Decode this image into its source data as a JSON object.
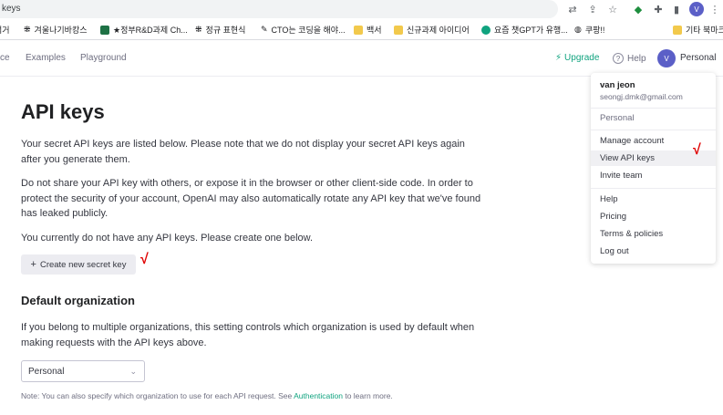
{
  "browser": {
    "address_text": "keys",
    "profile_initial": "V",
    "bookmarks": [
      {
        "label": "검거",
        "icon": "doc-icon",
        "color": "#5f6368"
      },
      {
        "label": "겨울나기바캉스",
        "icon": "t-icon",
        "color": "#333333"
      },
      {
        "label": "★정부R&D과제 Ch...",
        "icon": "excel-icon",
        "color": "#1e7145"
      },
      {
        "label": "정규 표현식",
        "icon": "t-icon",
        "color": "#333333"
      },
      {
        "label": "CTO는 코딩을 해야...",
        "icon": "pen-icon",
        "color": "#333333"
      },
      {
        "label": "백서",
        "icon": "folder-icon",
        "color": "#f2c94c"
      },
      {
        "label": "신규과제 아이디어",
        "icon": "folder-icon",
        "color": "#f2c94c"
      },
      {
        "label": "요즘 챗GPT가 유행...",
        "icon": "gpt-icon",
        "color": "#10a37f"
      },
      {
        "label": "쿠팡!!",
        "icon": "globe-icon",
        "color": "#333333"
      },
      {
        "label": "기타 북마크",
        "icon": "folder-icon",
        "color": "#f2c94c"
      }
    ]
  },
  "nav": {
    "partial_link": "ce",
    "examples": "Examples",
    "playground": "Playground",
    "upgrade": "Upgrade",
    "help": "Help",
    "avatar_initial": "V",
    "account": "Personal"
  },
  "main": {
    "title": "API keys",
    "para1": "Your secret API keys are listed below. Please note that we do not display your secret API keys again after you generate them.",
    "para2": "Do not share your API key with others, or expose it in the browser or other client-side code. In order to protect the security of your account, OpenAI may also automatically rotate any API key that we've found has leaked publicly.",
    "para3": "You currently do not have any API keys. Please create one below.",
    "create_button": "Create new secret key",
    "checkmark": "√",
    "org_title": "Default organization",
    "org_desc": "If you belong to multiple organizations, this setting controls which organization is used by default when making requests with the API keys above.",
    "org_selected": "Personal",
    "note_before": "Note: You can also specify which organization to use for each API request. See ",
    "note_link": "Authentication",
    "note_after": " to learn more."
  },
  "menu": {
    "name": "van jeon",
    "email": "seongj.dmk@gmail.com",
    "org": "Personal",
    "items_account": [
      "Manage account",
      "View API keys",
      "Invite team"
    ],
    "items_help": [
      "Help",
      "Pricing",
      "Terms & policies",
      "Log out"
    ]
  },
  "colors": {
    "accent": "#10a37f",
    "avatar": "#5b5fc7",
    "check": "#e00000"
  }
}
